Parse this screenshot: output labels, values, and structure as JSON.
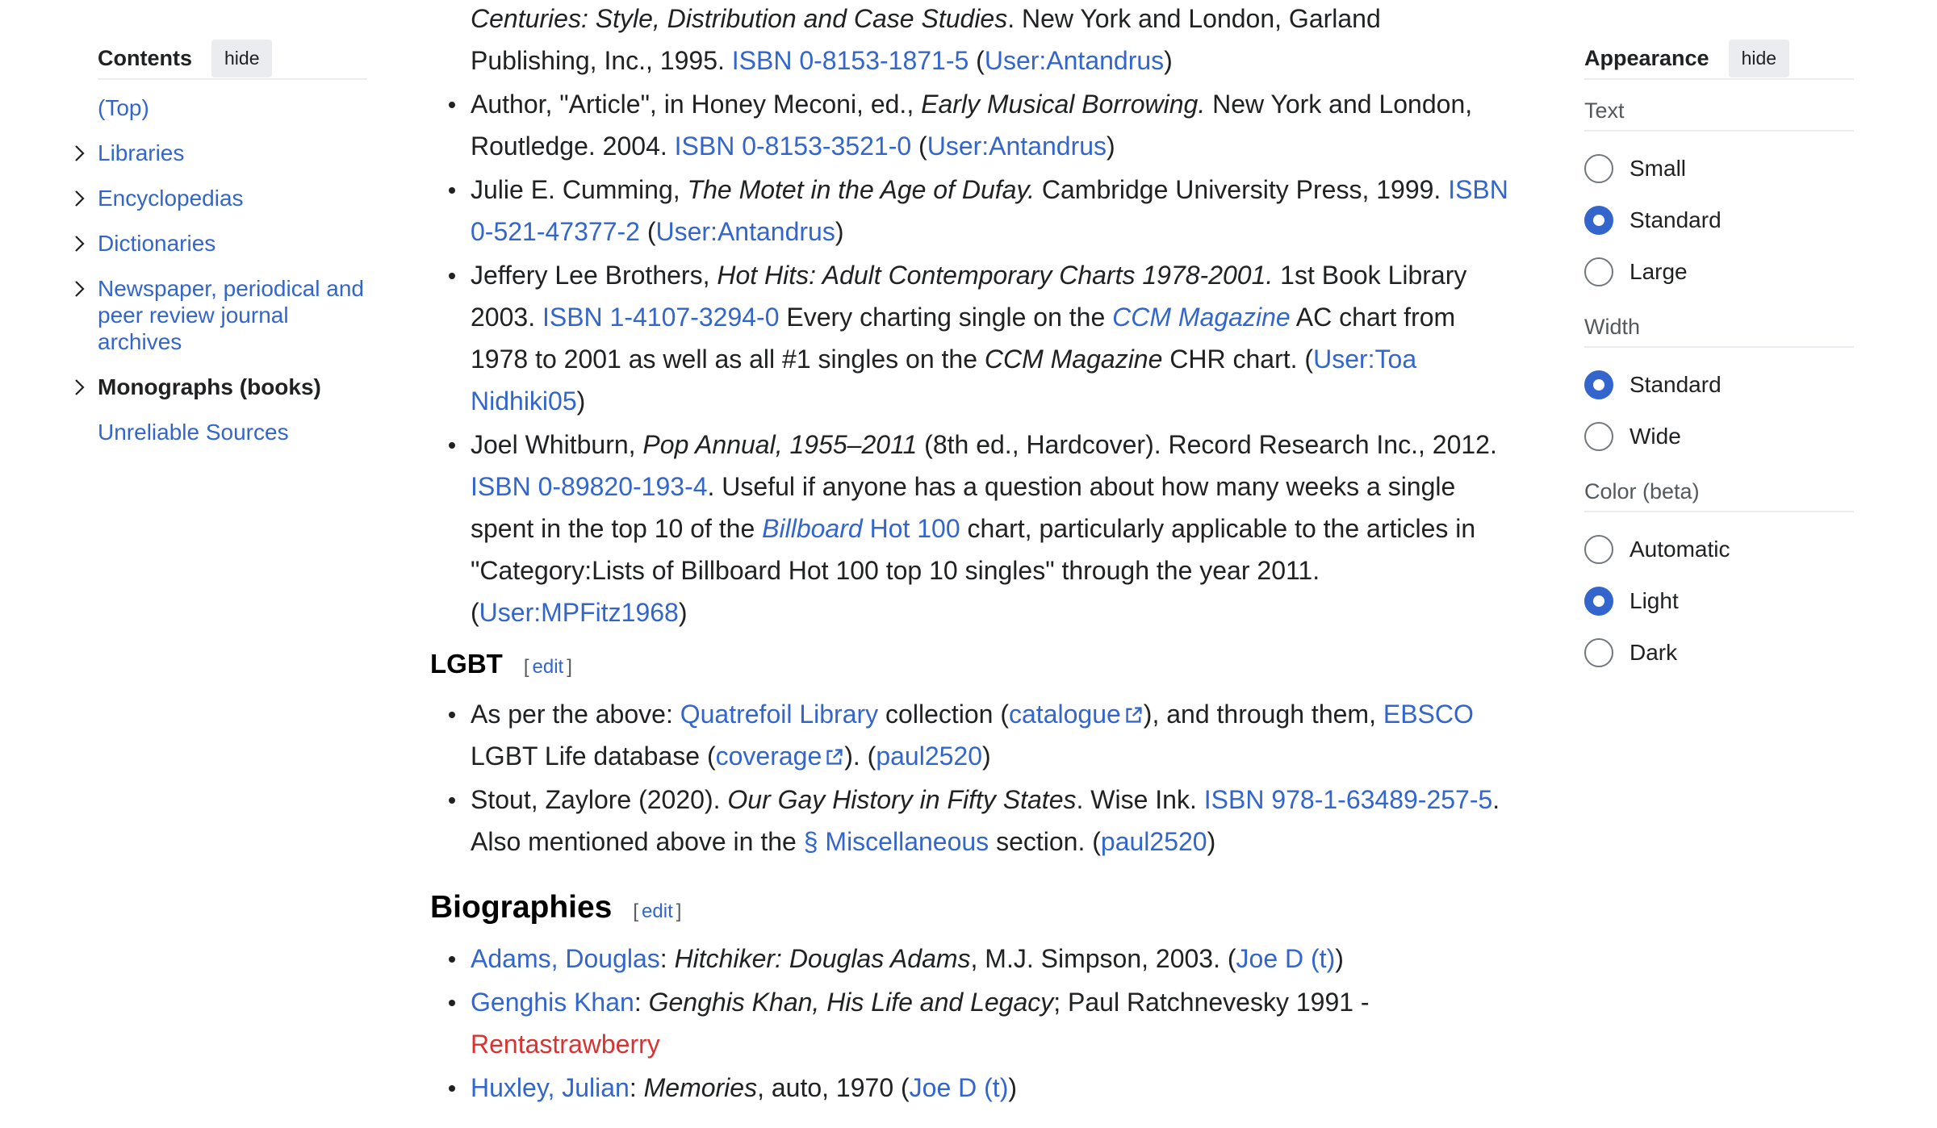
{
  "toc": {
    "title": "Contents",
    "hide_label": "hide",
    "items": [
      {
        "label": "(Top)",
        "has_toggle": false,
        "active": false
      },
      {
        "label": "Libraries",
        "has_toggle": true,
        "active": false
      },
      {
        "label": "Encyclopedias",
        "has_toggle": true,
        "active": false
      },
      {
        "label": "Dictionaries",
        "has_toggle": true,
        "active": false
      },
      {
        "label": "Newspaper, periodical and peer review journal archives",
        "has_toggle": true,
        "active": false
      },
      {
        "label": "Monographs (books)",
        "has_toggle": true,
        "active": true
      },
      {
        "label": "Unreliable Sources",
        "has_toggle": false,
        "active": false
      }
    ]
  },
  "content": {
    "top_list": [
      {
        "continuation": true,
        "parts": [
          {
            "t": "i",
            "v": "Centuries: Style, Distribution and Case Studies"
          },
          {
            "t": "s",
            "v": ". New York and London, Garland Publishing, Inc., 1995. "
          },
          {
            "t": "a",
            "v": "ISBN 0-8153-1871-5"
          },
          {
            "t": "s",
            "v": " ("
          },
          {
            "t": "a",
            "v": "User:Antandrus"
          },
          {
            "t": "s",
            "v": ")"
          }
        ]
      },
      {
        "parts": [
          {
            "t": "s",
            "v": "Author, \"Article\", in Honey Meconi, ed., "
          },
          {
            "t": "i",
            "v": "Early Musical Borrowing."
          },
          {
            "t": "s",
            "v": " New York and London, Routledge. 2004. "
          },
          {
            "t": "a",
            "v": "ISBN 0-8153-3521-0"
          },
          {
            "t": "s",
            "v": " ("
          },
          {
            "t": "a",
            "v": "User:Antandrus"
          },
          {
            "t": "s",
            "v": ")"
          }
        ]
      },
      {
        "parts": [
          {
            "t": "s",
            "v": "Julie E. Cumming, "
          },
          {
            "t": "i",
            "v": "The Motet in the Age of Dufay."
          },
          {
            "t": "s",
            "v": " Cambridge University Press, 1999. "
          },
          {
            "t": "a",
            "v": "ISBN 0-521-47377-2"
          },
          {
            "t": "s",
            "v": " ("
          },
          {
            "t": "a",
            "v": "User:Antandrus"
          },
          {
            "t": "s",
            "v": ")"
          }
        ]
      },
      {
        "parts": [
          {
            "t": "s",
            "v": "Jeffery Lee Brothers, "
          },
          {
            "t": "i",
            "v": "Hot Hits: Adult Contemporary Charts 1978-2001."
          },
          {
            "t": "s",
            "v": " 1st Book Library 2003. "
          },
          {
            "t": "a",
            "v": "ISBN 1-4107-3294-0"
          },
          {
            "t": "s",
            "v": " Every charting single on the "
          },
          {
            "t": "ai",
            "v": "CCM Magazine"
          },
          {
            "t": "s",
            "v": " AC chart from 1978 to 2001 as well as all #1 singles on the "
          },
          {
            "t": "i",
            "v": "CCM Magazine"
          },
          {
            "t": "s",
            "v": " CHR chart. ("
          },
          {
            "t": "a",
            "v": "User:Toa Nidhiki05"
          },
          {
            "t": "s",
            "v": ")"
          }
        ]
      },
      {
        "parts": [
          {
            "t": "s",
            "v": "Joel Whitburn, "
          },
          {
            "t": "i",
            "v": "Pop Annual, 1955–2011"
          },
          {
            "t": "s",
            "v": " (8th ed., Hardcover). Record Research Inc., 2012. "
          },
          {
            "t": "a",
            "v": "ISBN 0-89820-193-4"
          },
          {
            "t": "s",
            "v": ". Useful if anyone has a question about how many weeks a single spent in the top 10 of the "
          },
          {
            "t": "ai",
            "v": "Billboard"
          },
          {
            "t": "a",
            "v": " Hot 100"
          },
          {
            "t": "s",
            "v": " chart, particularly applicable to the articles in \"Category:Lists of Billboard Hot 100 top 10 singles\" through the year 2011. ("
          },
          {
            "t": "a",
            "v": "User:MPFitz1968"
          },
          {
            "t": "s",
            "v": ")"
          }
        ]
      }
    ],
    "lgbt": {
      "heading": "LGBT",
      "edit_open": "[",
      "edit_label": "edit",
      "edit_close": "]",
      "list": [
        {
          "parts": [
            {
              "t": "s",
              "v": "As per the above: "
            },
            {
              "t": "a",
              "v": "Quatrefoil Library"
            },
            {
              "t": "s",
              "v": " collection ("
            },
            {
              "t": "ext",
              "v": "catalogue"
            },
            {
              "t": "s",
              "v": "), and through them, "
            },
            {
              "t": "a",
              "v": "EBSCO"
            },
            {
              "t": "s",
              "v": " LGBT Life database ("
            },
            {
              "t": "ext",
              "v": "coverage"
            },
            {
              "t": "s",
              "v": "). ("
            },
            {
              "t": "a",
              "v": "paul2520"
            },
            {
              "t": "s",
              "v": ")"
            }
          ]
        },
        {
          "parts": [
            {
              "t": "s",
              "v": "Stout, Zaylore (2020). "
            },
            {
              "t": "i",
              "v": "Our Gay History in Fifty States"
            },
            {
              "t": "s",
              "v": ". Wise Ink. "
            },
            {
              "t": "a",
              "v": "ISBN 978-1-63489-257-5"
            },
            {
              "t": "s",
              "v": ". Also mentioned above in the "
            },
            {
              "t": "a",
              "v": "§ Miscellaneous"
            },
            {
              "t": "s",
              "v": " section. ("
            },
            {
              "t": "a",
              "v": "paul2520"
            },
            {
              "t": "s",
              "v": ")"
            }
          ]
        }
      ]
    },
    "biographies": {
      "heading": "Biographies",
      "edit_open": "[",
      "edit_label": "edit",
      "edit_close": "]",
      "list": [
        {
          "parts": [
            {
              "t": "a",
              "v": "Adams, Douglas"
            },
            {
              "t": "s",
              "v": ": "
            },
            {
              "t": "i",
              "v": "Hitchiker: Douglas Adams"
            },
            {
              "t": "s",
              "v": ", M.J. Simpson, 2003. ("
            },
            {
              "t": "a",
              "v": "Joe D"
            },
            {
              "t": "s",
              "v": " "
            },
            {
              "t": "a",
              "v": "(t)"
            },
            {
              "t": "s",
              "v": ")"
            }
          ]
        },
        {
          "parts": [
            {
              "t": "a",
              "v": "Genghis Khan"
            },
            {
              "t": "s",
              "v": ": "
            },
            {
              "t": "i",
              "v": "Genghis Khan, His Life and Legacy"
            },
            {
              "t": "s",
              "v": "; Paul Ratchnevesky 1991 - "
            },
            {
              "t": "red",
              "v": "Rentastrawberry"
            }
          ]
        },
        {
          "parts": [
            {
              "t": "a",
              "v": "Huxley, Julian"
            },
            {
              "t": "s",
              "v": ": "
            },
            {
              "t": "i",
              "v": "Memories"
            },
            {
              "t": "s",
              "v": ", auto, 1970 ("
            },
            {
              "t": "a",
              "v": "Joe D"
            },
            {
              "t": "s",
              "v": " "
            },
            {
              "t": "a",
              "v": "(t)"
            },
            {
              "t": "s",
              "v": ")"
            }
          ]
        }
      ]
    }
  },
  "appearance": {
    "title": "Appearance",
    "hide_label": "hide",
    "groups": [
      {
        "label": "Text",
        "options": [
          {
            "label": "Small",
            "checked": false
          },
          {
            "label": "Standard",
            "checked": true
          },
          {
            "label": "Large",
            "checked": false
          }
        ]
      },
      {
        "label": "Width",
        "options": [
          {
            "label": "Standard",
            "checked": true
          },
          {
            "label": "Wide",
            "checked": false
          }
        ]
      },
      {
        "label": "Color (beta)",
        "options": [
          {
            "label": "Automatic",
            "checked": false
          },
          {
            "label": "Light",
            "checked": true
          },
          {
            "label": "Dark",
            "checked": false
          }
        ]
      }
    ]
  },
  "colors": {
    "link": "#3366cc",
    "redlink": "#d73333",
    "text": "#202122",
    "radio_checked": "#3366cc",
    "button_bg": "#eaecf0"
  }
}
